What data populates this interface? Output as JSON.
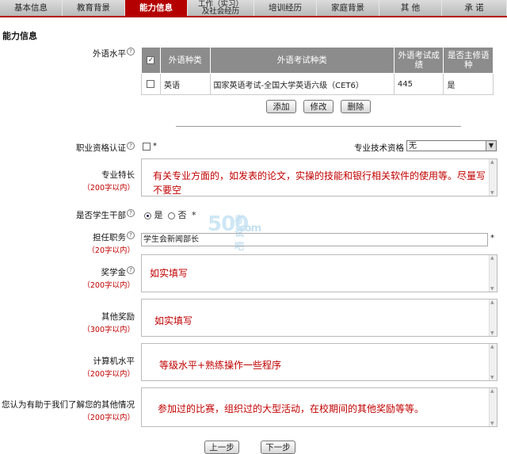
{
  "tabs": [
    {
      "label": "基本信息",
      "active": false
    },
    {
      "label": "教育背景",
      "active": false
    },
    {
      "label": "能力信息",
      "active": true
    },
    {
      "label_line1": "工作（实习）",
      "label_line2": "及社会经历",
      "active": false
    },
    {
      "label": "培训经历",
      "active": false
    },
    {
      "label": "家庭背景",
      "active": false
    },
    {
      "label": "其 他",
      "active": false
    },
    {
      "label": "承 诺",
      "active": false
    }
  ],
  "section_title": "能力信息",
  "language": {
    "label": "外语水平",
    "help": "?",
    "headers": [
      "外语种类",
      "外语考试种类",
      "外语考试成绩",
      "是否主修语种"
    ],
    "rows": [
      {
        "checked": false,
        "kind": "英语",
        "exam": "国家英语考试-全国大学英语六级（CET6）",
        "score": "445",
        "major": "是"
      }
    ],
    "buttons": {
      "add": "添加",
      "edit": "修改",
      "delete": "删除"
    }
  },
  "qualification": {
    "label": "职业资格认证",
    "help": "?",
    "required": "*"
  },
  "tech_title": {
    "label": "专业技术资格",
    "value": "无"
  },
  "specialty": {
    "label": "专业特长",
    "limit": "（200字以内）",
    "value": "有关专业方面的，如发表的论文，实操的技能和银行相关软件的使用等。尽量写不要空"
  },
  "cadre": {
    "label": "是否学生干部",
    "help": "?",
    "yes": "是",
    "no": "否",
    "required": "*"
  },
  "position": {
    "label": "担任职务",
    "help": "?",
    "limit": "（20字以内）",
    "value": "学生会新闻部长",
    "required": "*"
  },
  "scholarship": {
    "label": "奖学金",
    "help": "?",
    "limit": "（200字以内）",
    "value": "如实填写"
  },
  "other_awards": {
    "label": "其他奖励",
    "limit": "（300字以内）",
    "value": "如实填写"
  },
  "computer": {
    "label": "计算机水平",
    "limit": "（200字以内）",
    "value": "等级水平+熟练操作一些程序"
  },
  "other_info": {
    "label": "您认为有助于我们了解您的其他情况",
    "limit": "（200字以内）",
    "value": "参加过的比赛，组织过的大型活动，在校期间的其他奖励等等。"
  },
  "nav": {
    "prev": "上一步",
    "next": "下一步"
  },
  "watermark": {
    "number": "500",
    "text": "考试吧",
    "domain": ".com"
  }
}
